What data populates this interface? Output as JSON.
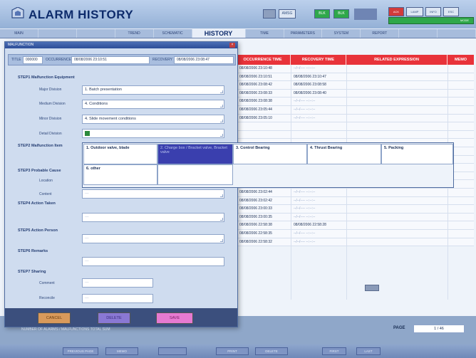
{
  "header": {
    "title": "ALARM HISTORY",
    "buttons": [
      "AMSG",
      "BLK",
      "BLK"
    ],
    "right_buttons": [
      "ACK",
      "LAMP",
      "INFO",
      "ESC"
    ],
    "mode": "MODE",
    "colors": {
      "green": "#2fa84a",
      "red": "#d23b3b",
      "blue": "#1f3fa6"
    }
  },
  "tabs": [
    "MAIN",
    "",
    "",
    "TREND",
    "SCHEMATIC",
    "HISTORY",
    "TIME",
    "PARAMETERS",
    "SYSTEM",
    "REPORT",
    "",
    ""
  ],
  "table": {
    "headers": [
      "OCCURRENCE TIME",
      "RECOVERY TIME",
      "RELATED EXPRESSION",
      "MEMO"
    ],
    "rows": [
      {
        "occ": "08/08/2006 23:10:48",
        "rec": "--/--/---- --:--:--",
        "recovered": false
      },
      {
        "occ": "08/08/2006 23:10:51",
        "rec": "08/08/2006 23:10:47",
        "recovered": true
      },
      {
        "occ": "08/08/2006 23:08:42",
        "rec": "08/08/2006 23:08:58",
        "recovered": true
      },
      {
        "occ": "08/08/2006 23:08:33",
        "rec": "08/08/2006 23:08:40",
        "recovered": true
      },
      {
        "occ": "08/08/2006 23:08:38",
        "rec": "--/--/---- --:--:--",
        "recovered": false
      },
      {
        "occ": "08/08/2006 23:05:44",
        "rec": "--/--/---- --:--:--",
        "recovered": false
      },
      {
        "occ": "08/08/2006 23:05:10",
        "rec": "--/--/---- --:--:--",
        "recovered": false
      },
      {
        "occ": "",
        "rec": "",
        "recovered": false
      },
      {
        "occ": "",
        "rec": "",
        "recovered": false
      },
      {
        "occ": "",
        "rec": "",
        "recovered": false
      },
      {
        "occ": "",
        "rec": "",
        "recovered": false
      },
      {
        "occ": "",
        "rec": "",
        "recovered": false
      },
      {
        "occ": "",
        "rec": "",
        "recovered": false
      },
      {
        "occ": "08/08/2006 23:08:18",
        "rec": "--/--/---- --:--:--",
        "recovered": false
      },
      {
        "occ": "08/08/2006 23:08:41",
        "rec": "--/--/---- --:--:--",
        "recovered": false
      },
      {
        "occ": "08/08/2006 23:02:44",
        "rec": "--/--/---- --:--:--",
        "recovered": false
      },
      {
        "occ": "08/08/2006 23:02:42",
        "rec": "--/--/---- --:--:--",
        "recovered": false
      },
      {
        "occ": "08/08/2006 23:00:33",
        "rec": "--/--/---- --:--:--",
        "recovered": false
      },
      {
        "occ": "08/08/2006 23:00:35",
        "rec": "--/--/---- --:--:--",
        "recovered": false
      },
      {
        "occ": "08/08/2006 22:58:38",
        "rec": "08/08/2006 22:58:28",
        "recovered": true
      },
      {
        "occ": "08/08/2006 22:58:35",
        "rec": "--/--/---- --:--:--",
        "recovered": false
      },
      {
        "occ": "08/08/2006 22:58:32",
        "rec": "--/--/---- --:--:--",
        "recovered": false
      }
    ]
  },
  "dialog": {
    "title": "MALFUNCTION",
    "filter": {
      "title_label": "TITLE",
      "title_value": "000000",
      "occ_label": "OCCURRENCE",
      "occ_value": "08/08/2006 23:10:51",
      "rec_label": "RECOVERY",
      "rec_value": "08/08/2006 23:08:47"
    },
    "step1": {
      "label": "STEP1  Malfunction Equipment",
      "fields": [
        {
          "label": "Major Division",
          "value": "1. Batch presentation"
        },
        {
          "label": "Medium Division",
          "value": "4. Conditions"
        },
        {
          "label": "Minor Division",
          "value": "4. Slide movement conditions"
        },
        {
          "label": "Detail Division",
          "value": ""
        }
      ]
    },
    "step2": {
      "label": "STEP2  Malfunction Item"
    },
    "step3": {
      "label": "STEP3  Probable Cause",
      "sub1": "Location",
      "sub2": "Content",
      "content_value": "---"
    },
    "step4": {
      "label": "STEP4  Action Taken",
      "value": "---"
    },
    "step5": {
      "label": "STEP5  Action Person",
      "value": "---"
    },
    "step6": {
      "label": "STEP6  Remarks",
      "value": "---"
    },
    "step7": {
      "label": "STEP7  Sharing",
      "sub1": "Comment",
      "sub2": "Reconcile",
      "v1": "---",
      "v2": "---"
    },
    "buttons": {
      "cancel": "CANCEL",
      "delete": "DELETE",
      "save": "SAVE"
    }
  },
  "popup": {
    "items": [
      "1. Outdoor valve, blade",
      "2. Charge box / Bracket valve, Bracket valve",
      "3. Control Bearing",
      "4. Thrust Bearing",
      "5. Packing",
      "6. other",
      ""
    ]
  },
  "status_line": "NUMBER OF ALARMS / MALFUNCTIONS    TOTAL    SUM",
  "page": {
    "label": "PAGE",
    "value": "1 / 46"
  },
  "footer_buttons": [
    "PREVIOUS PAGE",
    "MEMO",
    "",
    "PRINT",
    "DELETE",
    "FIRST",
    "LAST"
  ]
}
